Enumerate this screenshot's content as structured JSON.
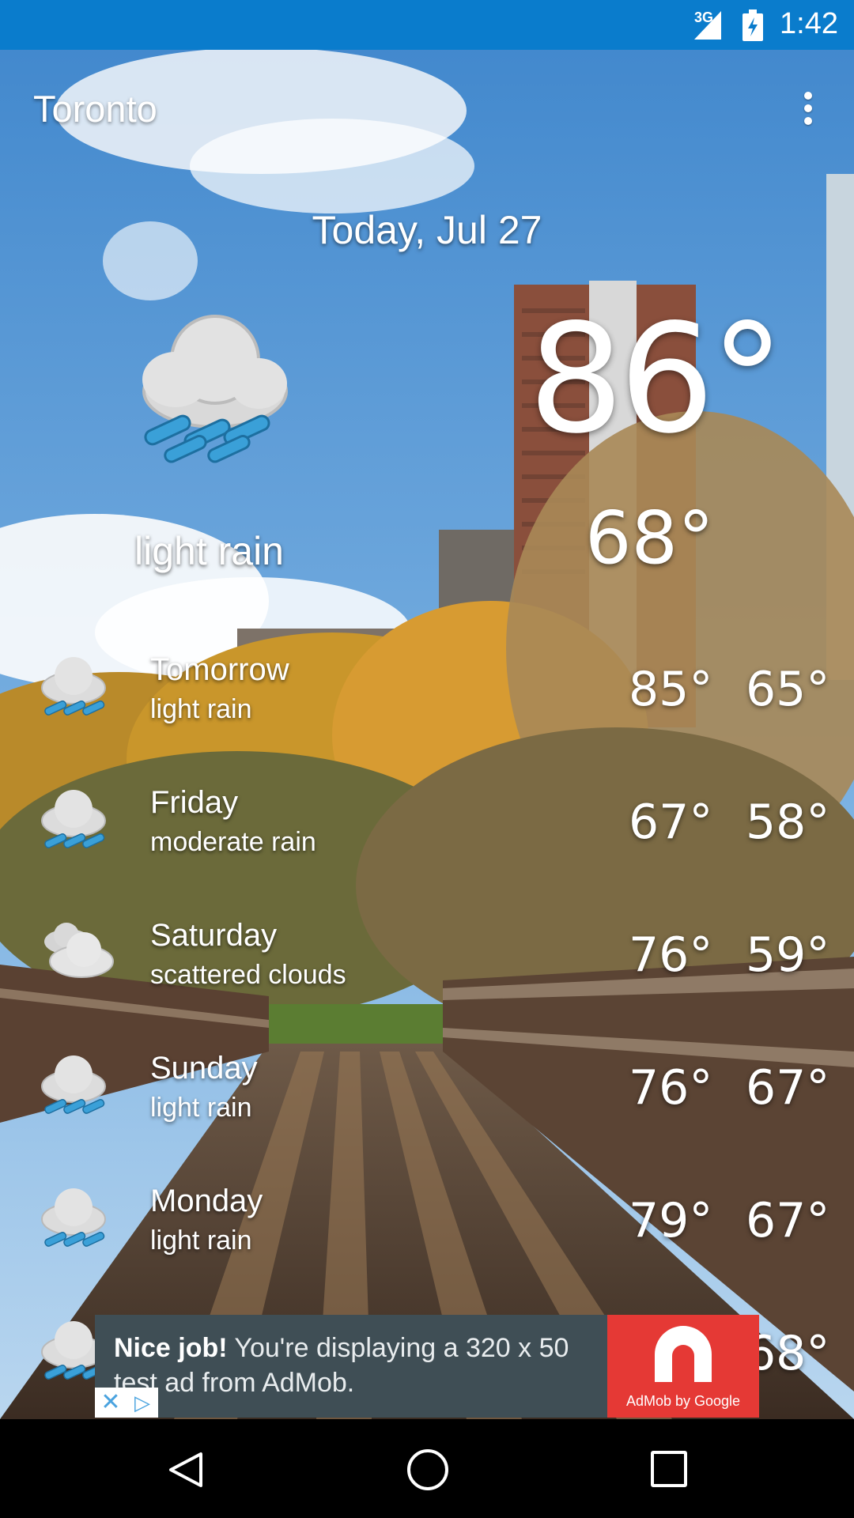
{
  "status_bar": {
    "network": "3G",
    "time": "1:42",
    "background_color": "#0a7ccc"
  },
  "header": {
    "city": "Toronto",
    "menu_icon": "overflow-menu-icon"
  },
  "today": {
    "date": "Today, Jul 27",
    "icon": "light-rain-icon",
    "condition": "light rain",
    "high": "86°",
    "low": "68°"
  },
  "forecast": [
    {
      "day": "Tomorrow",
      "condition": "light rain",
      "icon": "light-rain-icon",
      "high": "85°",
      "low": "65°"
    },
    {
      "day": "Friday",
      "condition": "moderate rain",
      "icon": "moderate-rain-icon",
      "high": "67°",
      "low": "58°"
    },
    {
      "day": "Saturday",
      "condition": "scattered clouds",
      "icon": "scattered-clouds-icon",
      "high": "76°",
      "low": "59°"
    },
    {
      "day": "Sunday",
      "condition": "light rain",
      "icon": "light-rain-icon",
      "high": "76°",
      "low": "67°"
    },
    {
      "day": "Monday",
      "condition": "light rain",
      "icon": "light-rain-icon",
      "high": "79°",
      "low": "67°"
    },
    {
      "day": "",
      "condition": "",
      "icon": "light-rain-icon",
      "high": "",
      "low": "68°"
    }
  ],
  "ad": {
    "headline": "Nice job!",
    "body": "You're displaying a 320 x 50 test ad from AdMob.",
    "logo_caption": "AdMob by Google",
    "close_icon": "close-icon",
    "adchoices_icon": "adchoices-icon",
    "background_color": "#3f4e55",
    "logo_color": "#e53935"
  },
  "nav_bar": {
    "back_icon": "back-icon",
    "home_icon": "home-icon",
    "recents_icon": "recents-icon"
  }
}
